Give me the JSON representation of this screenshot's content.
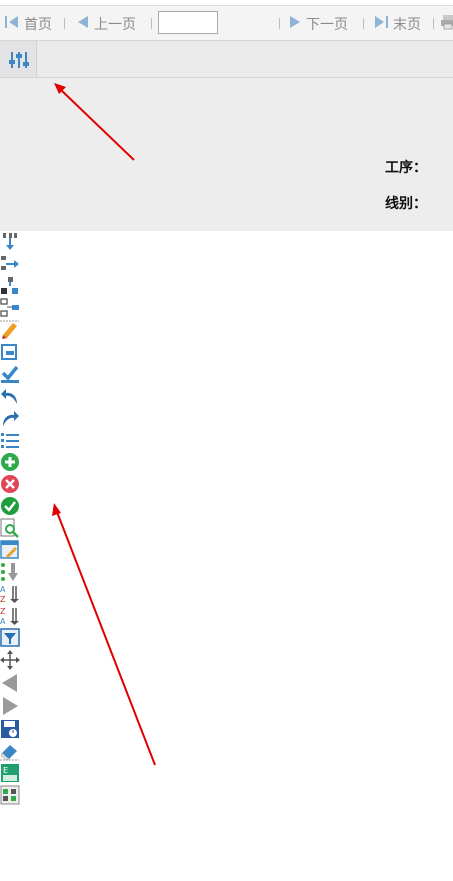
{
  "pager": {
    "first_label": "首页",
    "prev_label": "上一页",
    "page_value": "",
    "next_label": "下一页",
    "last_label": "末页"
  },
  "toolbar": {
    "settings_icon": "sliders-icon"
  },
  "filters": {
    "process_label": "工序：",
    "line_label": "线别："
  },
  "side_tools": [
    "merge-down-icon",
    "split-right-icon",
    "tree-icon",
    "tree-branch-icon",
    "pencil-icon",
    "edit-box-icon",
    "check-mark-icon",
    "undo-icon",
    "redo-icon",
    "list-icon",
    "add-icon",
    "delete-icon",
    "confirm-icon",
    "search-doc-icon",
    "edit-doc-icon",
    "list-down-icon",
    "sort-az-icon",
    "sort-za-icon",
    "filter-icon",
    "move-icon",
    "arrow-left-icon",
    "arrow-right-icon",
    "save-icon",
    "eraser-icon",
    "excel-icon",
    "export-icon"
  ],
  "colors": {
    "annotation_arrow": "#e00000",
    "accent_blue": "#3a87c8"
  }
}
